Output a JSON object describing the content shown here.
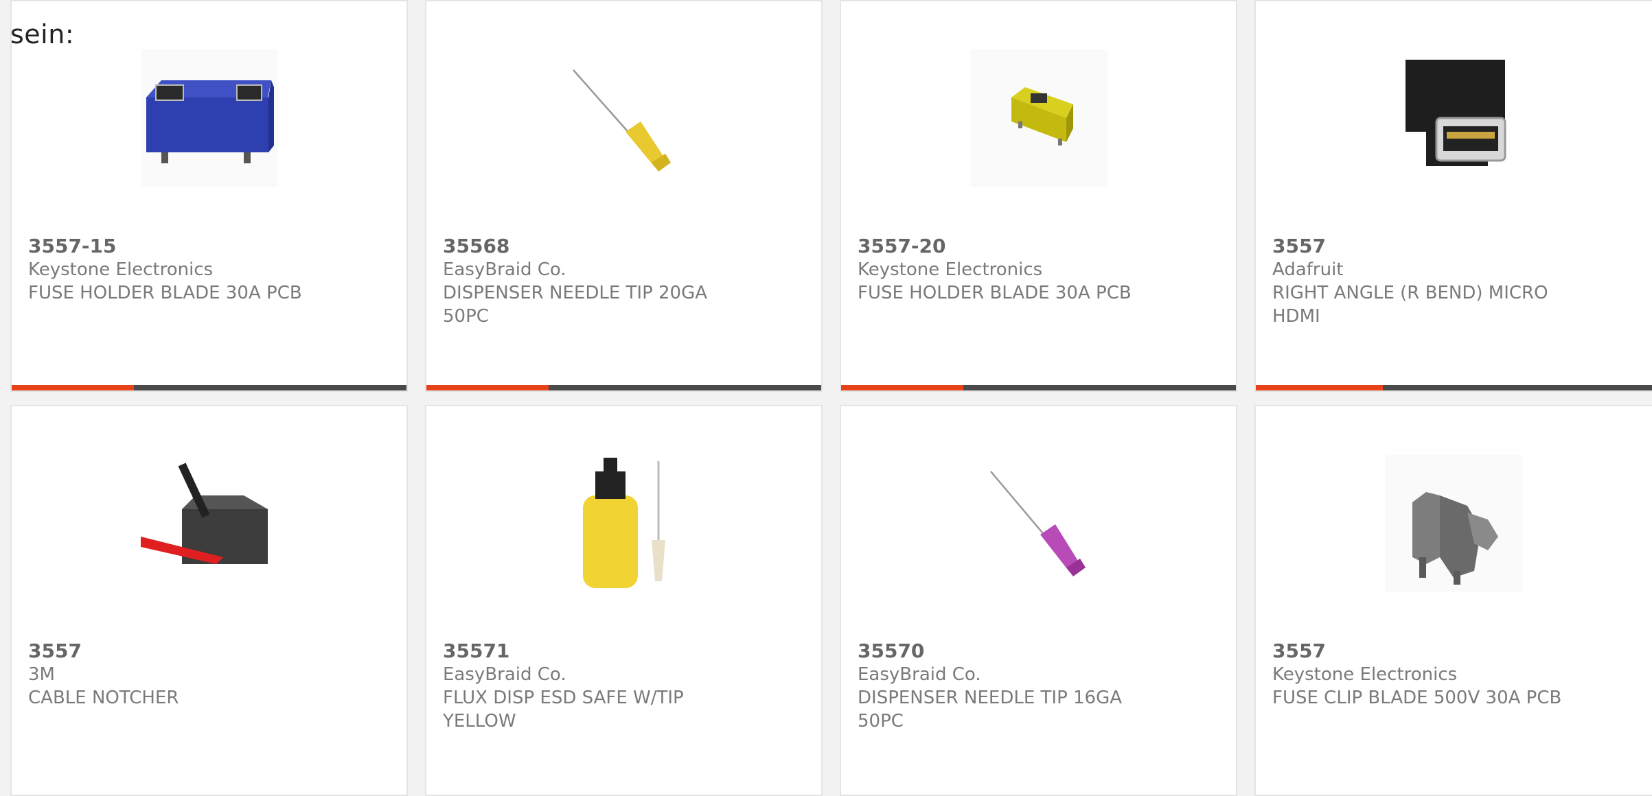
{
  "intro_text": "sein:",
  "accent": "#e8421b",
  "products": [
    {
      "part_number": "3557-15",
      "manufacturer": "Keystone Electronics",
      "description": "FUSE HOLDER BLADE 30A PCB",
      "icon": "blue-fuse-holder-icon",
      "progress": 0.31
    },
    {
      "part_number": "35568",
      "manufacturer": "EasyBraid Co.",
      "description": "DISPENSER NEEDLE TIP 20GA 50PC",
      "icon": "yellow-needle-tip-icon",
      "progress": 0.31
    },
    {
      "part_number": "3557-20",
      "manufacturer": "Keystone Electronics",
      "description": "FUSE HOLDER BLADE 30A PCB",
      "icon": "yellow-fuse-holder-icon",
      "progress": 0.31
    },
    {
      "part_number": "3557",
      "manufacturer": "Adafruit",
      "description": "RIGHT ANGLE (R BEND) MICRO HDMI",
      "icon": "micro-hdmi-adapter-icon",
      "progress": 0.31
    },
    {
      "part_number": "3557",
      "manufacturer": "3M",
      "description": "CABLE NOTCHER",
      "icon": "cable-notcher-icon"
    },
    {
      "part_number": "35571",
      "manufacturer": "EasyBraid Co.",
      "description": "FLUX DISP ESD SAFE W/TIP YELLOW",
      "icon": "flux-dispenser-bottle-icon"
    },
    {
      "part_number": "35570",
      "manufacturer": "EasyBraid Co.",
      "description": "DISPENSER NEEDLE TIP 16GA 50PC",
      "icon": "purple-needle-tip-icon"
    },
    {
      "part_number": "3557",
      "manufacturer": "Keystone Electronics",
      "description": "FUSE CLIP BLADE 500V 30A PCB",
      "icon": "fuse-clip-icon"
    }
  ]
}
